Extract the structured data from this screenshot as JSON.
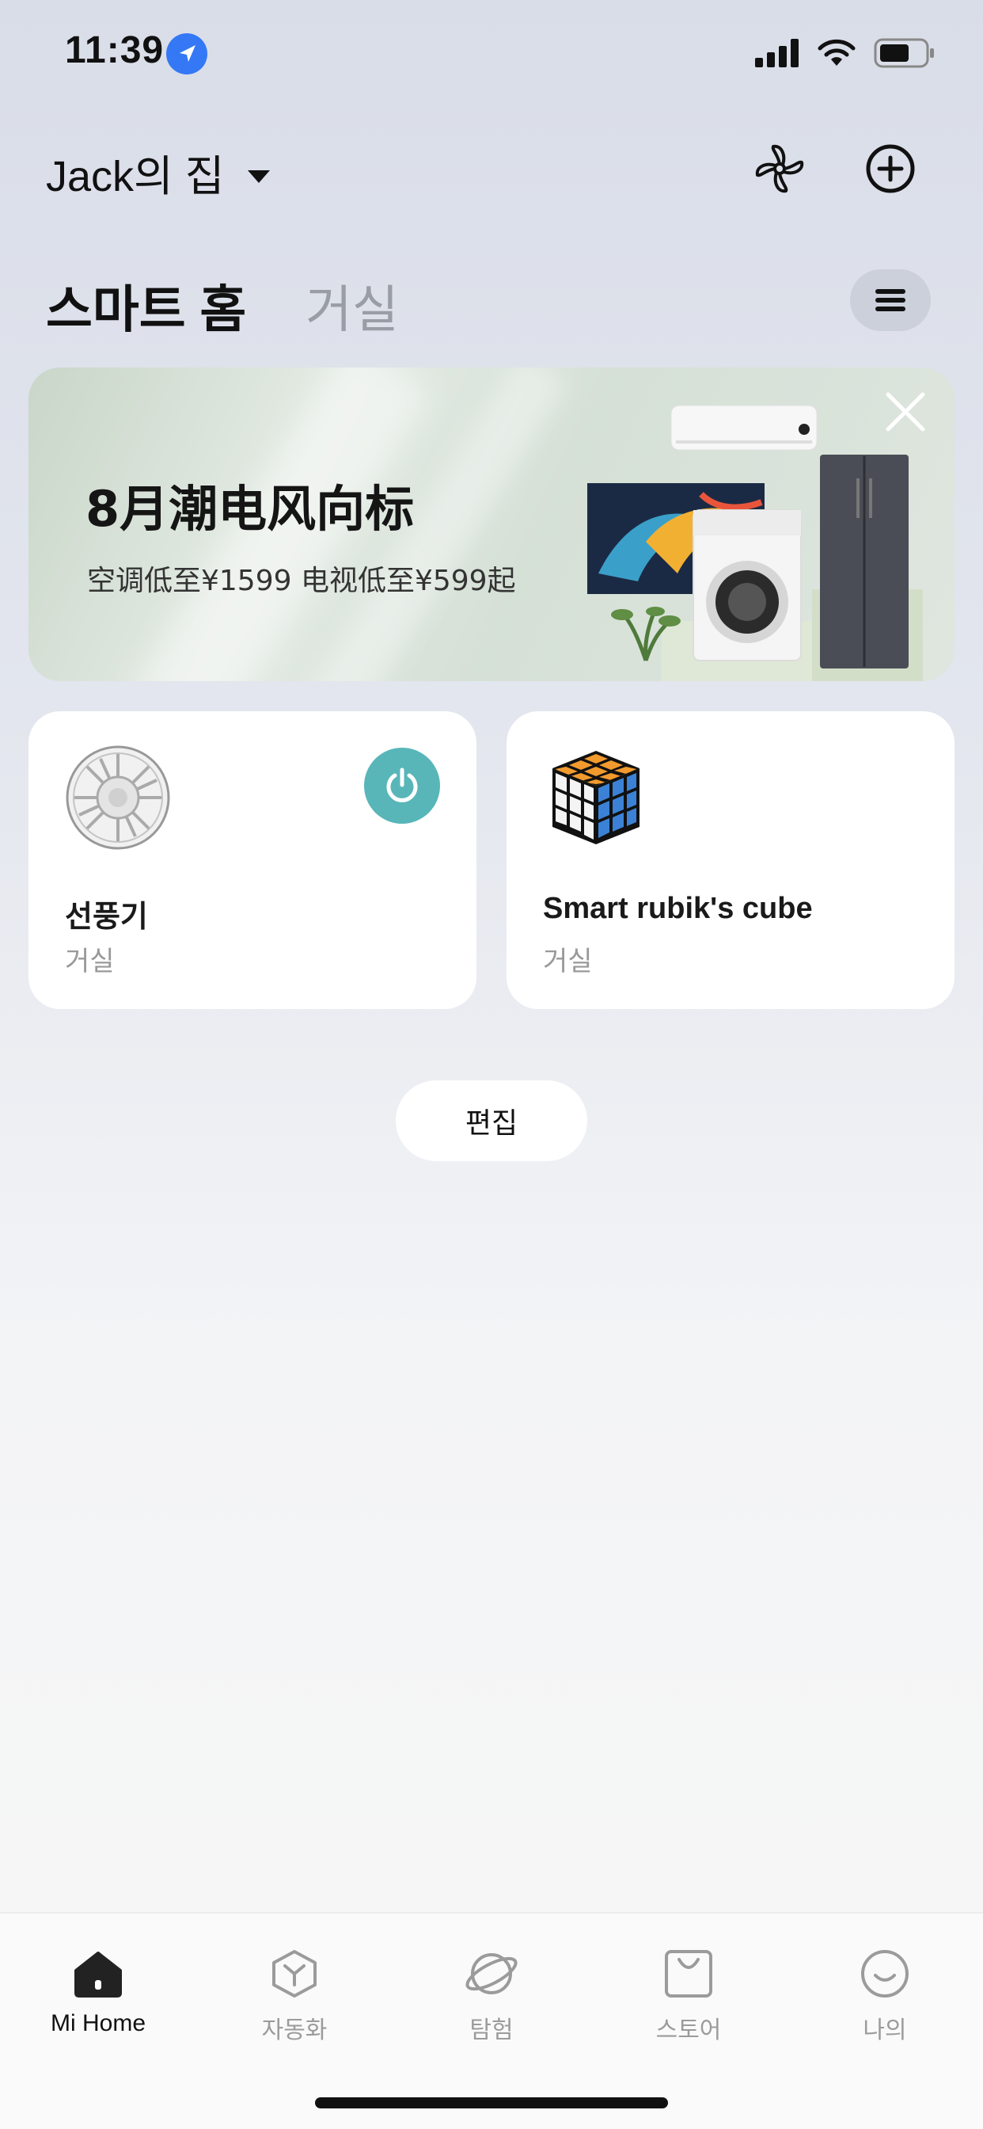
{
  "status_bar": {
    "time": "11:39",
    "icons": [
      "location-arrow-icon",
      "cellular-signal-icon",
      "wifi-icon",
      "battery-icon"
    ]
  },
  "header": {
    "home_name": "Jack의 집",
    "actions": [
      "fan-icon",
      "add-circle-icon"
    ]
  },
  "tabs": [
    {
      "label": "스마트 홈",
      "active": true
    },
    {
      "label": "거실",
      "active": false
    }
  ],
  "banner": {
    "title": "8月潮电风向标",
    "subtitle": "空调低至¥1599 电视低至¥599起"
  },
  "devices": [
    {
      "name": "선풍기",
      "room": "거실",
      "icon": "fan-device-icon",
      "power": true
    },
    {
      "name": "Smart rubik's cube",
      "room": "거실",
      "icon": "rubiks-cube-icon",
      "power": false
    }
  ],
  "edit_label": "편집",
  "bottom_nav": [
    {
      "label": "Mi Home",
      "icon": "home-icon",
      "active": true
    },
    {
      "label": "자동화",
      "icon": "cube-automation-icon",
      "active": false
    },
    {
      "label": "탐험",
      "icon": "planet-icon",
      "active": false
    },
    {
      "label": "스토어",
      "icon": "shopping-bag-icon",
      "active": false
    },
    {
      "label": "나의",
      "icon": "smile-icon",
      "active": false
    }
  ],
  "colors": {
    "accent_power": "#58b6b9",
    "location_blue": "#3478f6",
    "inactive_text": "#9a9da6"
  }
}
